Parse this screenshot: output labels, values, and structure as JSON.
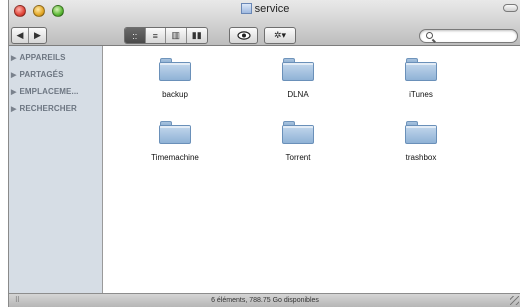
{
  "window": {
    "title": "service"
  },
  "toolbar": {
    "back_icon": "◀",
    "forward_icon": "▶",
    "view_icons": [
      "::",
      "≡",
      "▥",
      "▮▮"
    ],
    "quicklook_icon": "eye-icon",
    "action_icon": "✲▾"
  },
  "search": {
    "placeholder": ""
  },
  "sidebar": {
    "sections": [
      {
        "label": "APPAREILS"
      },
      {
        "label": "PARTAGÉS"
      },
      {
        "label": "EMPLACEME..."
      },
      {
        "label": "RECHERCHER"
      }
    ]
  },
  "files": [
    {
      "name": "backup"
    },
    {
      "name": "DLNA"
    },
    {
      "name": "iTunes"
    },
    {
      "name": "Timemachine"
    },
    {
      "name": "Torrent"
    },
    {
      "name": "trashbox"
    }
  ],
  "status": {
    "text": "6 éléments, 788.75 Go disponibles"
  },
  "colors": {
    "sidebar_bg": "#d6dde5",
    "folder_blue": "#8fb2d6"
  }
}
